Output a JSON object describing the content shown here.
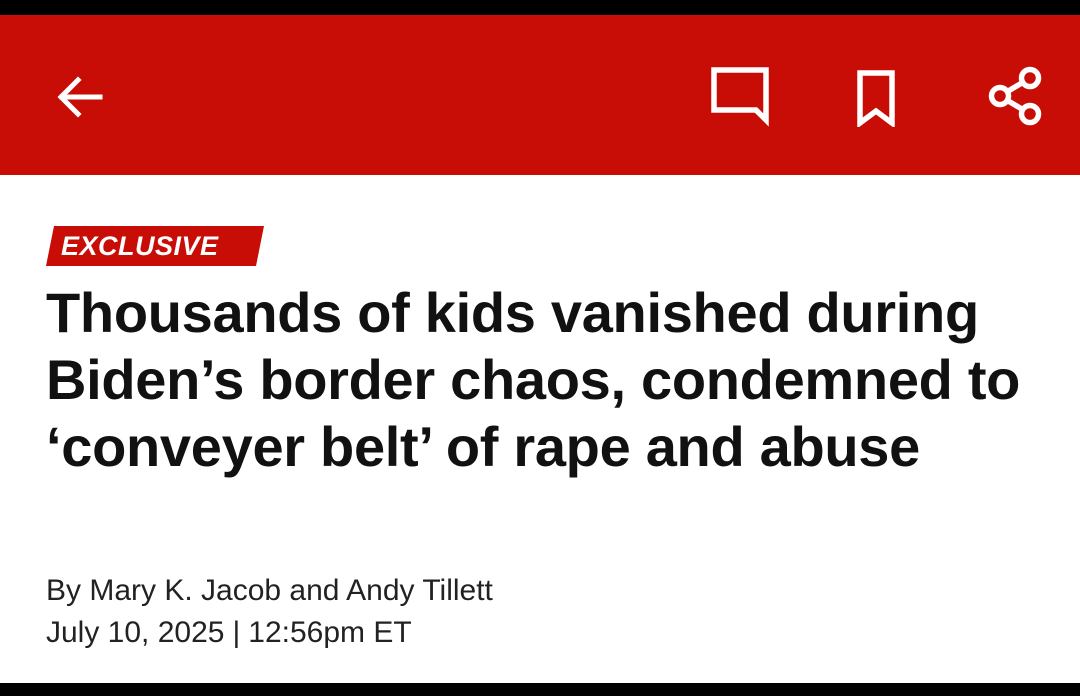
{
  "app_bar": {
    "color": "#c70d06",
    "icons": [
      "back-arrow-icon",
      "comment-icon",
      "bookmark-icon",
      "share-icon"
    ]
  },
  "article": {
    "badge": "EXCLUSIVE",
    "headline": "Thousands of kids vanished during Biden’s border chaos, condemned to ‘conveyer belt’ of rape and abuse",
    "byline": "By Mary K. Jacob and Andy Tillett",
    "date": "July 10, 2025",
    "separator": "|",
    "time": "12:56pm ET"
  }
}
